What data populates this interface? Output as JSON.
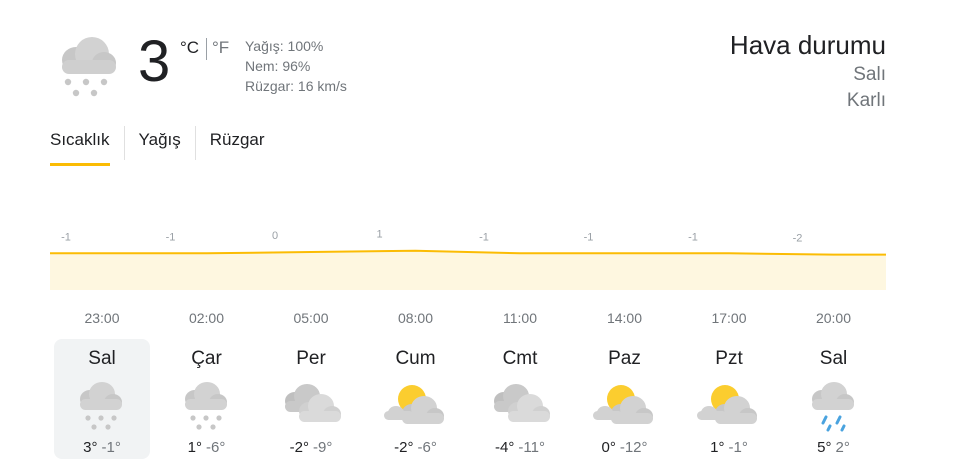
{
  "current": {
    "icon": "snow-cloud-icon",
    "temperature": "3",
    "unit_c": "°C",
    "unit_f": "°F",
    "precipitation": "Yağış: 100%",
    "humidity": "Nem: 96%",
    "wind": "Rüzgar: 16 km/s"
  },
  "header": {
    "title": "Hava durumu",
    "day": "Salı",
    "condition": "Karlı"
  },
  "tabs": [
    {
      "label": "Sıcaklık",
      "active": true
    },
    {
      "label": "Yağış",
      "active": false
    },
    {
      "label": "Rüzgar",
      "active": false
    }
  ],
  "colors": {
    "accent": "#fbbc04",
    "fill": "#fef7e0",
    "label": "#9aa0a6"
  },
  "chart_data": {
    "type": "area",
    "x": [
      "23:00",
      "02:00",
      "05:00",
      "08:00",
      "11:00",
      "14:00",
      "17:00",
      "20:00"
    ],
    "values": [
      -1,
      -1,
      0,
      1,
      -1,
      -1,
      -1,
      -2
    ],
    "labels": [
      "-1",
      "-1",
      "0",
      "1",
      "-1",
      "-1",
      "-1",
      "-2"
    ],
    "series": [
      {
        "values": [
          -1,
          -1,
          0,
          1,
          -1,
          -1,
          -1,
          -2
        ]
      }
    ]
  },
  "forecast": [
    {
      "day": "Sal",
      "icon": "snow",
      "hi": "3°",
      "lo": "-1°",
      "selected": true
    },
    {
      "day": "Çar",
      "icon": "snow",
      "hi": "1°",
      "lo": "-6°",
      "selected": false
    },
    {
      "day": "Per",
      "icon": "cloudy",
      "hi": "-2°",
      "lo": "-9°",
      "selected": false
    },
    {
      "day": "Cum",
      "icon": "partly-cloudy",
      "hi": "-2°",
      "lo": "-6°",
      "selected": false
    },
    {
      "day": "Cmt",
      "icon": "cloudy",
      "hi": "-4°",
      "lo": "-11°",
      "selected": false
    },
    {
      "day": "Paz",
      "icon": "partly-cloudy",
      "hi": "0°",
      "lo": "-12°",
      "selected": false
    },
    {
      "day": "Pzt",
      "icon": "partly-cloudy",
      "hi": "1°",
      "lo": "-1°",
      "selected": false
    },
    {
      "day": "Sal",
      "icon": "rain",
      "hi": "5°",
      "lo": "2°",
      "selected": false
    }
  ]
}
